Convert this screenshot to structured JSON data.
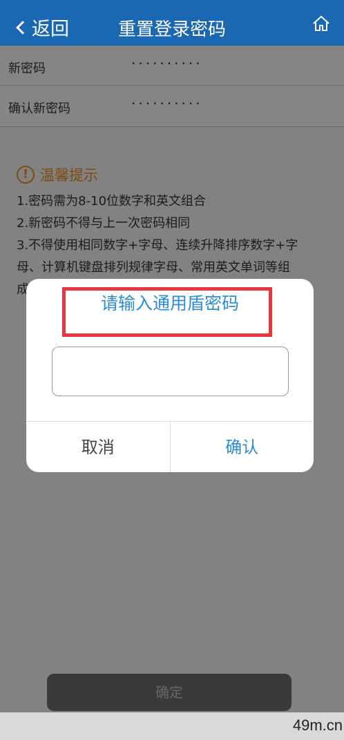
{
  "header": {
    "back_label": "返回",
    "title": "重置登录密码"
  },
  "form": {
    "new_password_label": "新密码",
    "new_password_value": "··········",
    "confirm_password_label": "确认新密码",
    "confirm_password_value": "··········"
  },
  "tips": {
    "heading": "温馨提示",
    "line1": "1.密码需为8-10位数字和英文组合",
    "line2": "2.新密码不得与上一次密码相同",
    "line3": "3.不得使用相同数字+字母、连续升降排序数字+字",
    "line4": "母、计算机键盘排列规律字母、常用英文单词等组",
    "line5": "成"
  },
  "dialog": {
    "title": "请输入通用盾密码",
    "input_value": "",
    "cancel_label": "取消",
    "confirm_label": "确认"
  },
  "confirm_button_label": "确定",
  "watermark": "49m.cn",
  "colors": {
    "header": "#1a67b3",
    "accent": "#2d8cd5",
    "warning": "#e48a1e",
    "highlight_box": "#e8363f"
  }
}
